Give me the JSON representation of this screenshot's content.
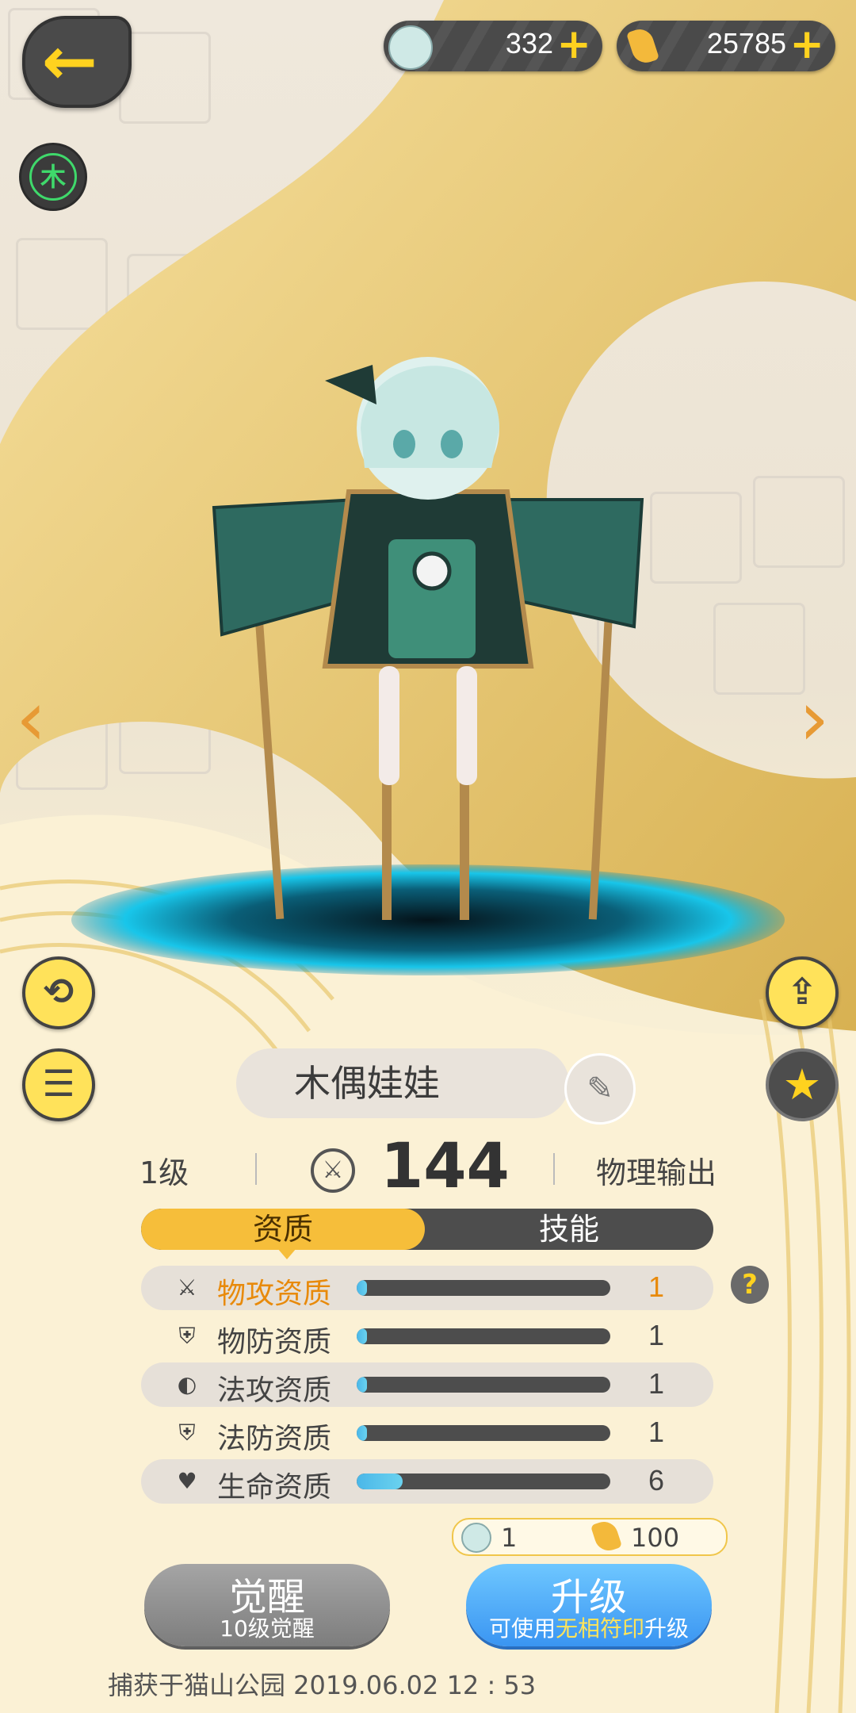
{
  "top_bar": {
    "currency_1": {
      "amount": "332",
      "icon": "doll-token-icon"
    },
    "currency_2": {
      "amount": "25785",
      "icon": "gold-crystal-icon"
    },
    "plus_symbol": "+"
  },
  "element_badge": "木",
  "character": {
    "name": "木偶娃娃",
    "level": "1级",
    "power": "144",
    "role": "物理输出"
  },
  "tabs": [
    {
      "label": "资质",
      "active": true
    },
    {
      "label": "技能",
      "active": false
    }
  ],
  "attributes": [
    {
      "label": "物攻资质",
      "value": "1",
      "fill": 0.02,
      "icon": "crossed-swords-icon",
      "highlight": true
    },
    {
      "label": "物防资质",
      "value": "1",
      "fill": 0.02,
      "icon": "shield-icon",
      "highlight": false
    },
    {
      "label": "法攻资质",
      "value": "1",
      "fill": 0.02,
      "icon": "magic-orb-icon",
      "highlight": false
    },
    {
      "label": "法防资质",
      "value": "1",
      "fill": 0.02,
      "icon": "magic-shield-icon",
      "highlight": false
    },
    {
      "label": "生命资质",
      "value": "6",
      "fill": 0.18,
      "icon": "heart-icon",
      "highlight": false
    }
  ],
  "help_symbol": "?",
  "cost": {
    "doll_tokens": "1",
    "gold": "100"
  },
  "buttons": {
    "awaken": {
      "title": "觉醒",
      "subtitle": "10级觉醒"
    },
    "upgrade": {
      "title": "升级",
      "subtitle_pre": "可使用",
      "subtitle_highlight": "无相符印",
      "subtitle_post": "升级"
    }
  },
  "footer": "捕获于猫山公园  2019.06.02    12 : 53",
  "colors": {
    "gold": "#f6be3a",
    "accent_orange": "#e88a0b",
    "upgrade_blue": "#3a95f2"
  }
}
